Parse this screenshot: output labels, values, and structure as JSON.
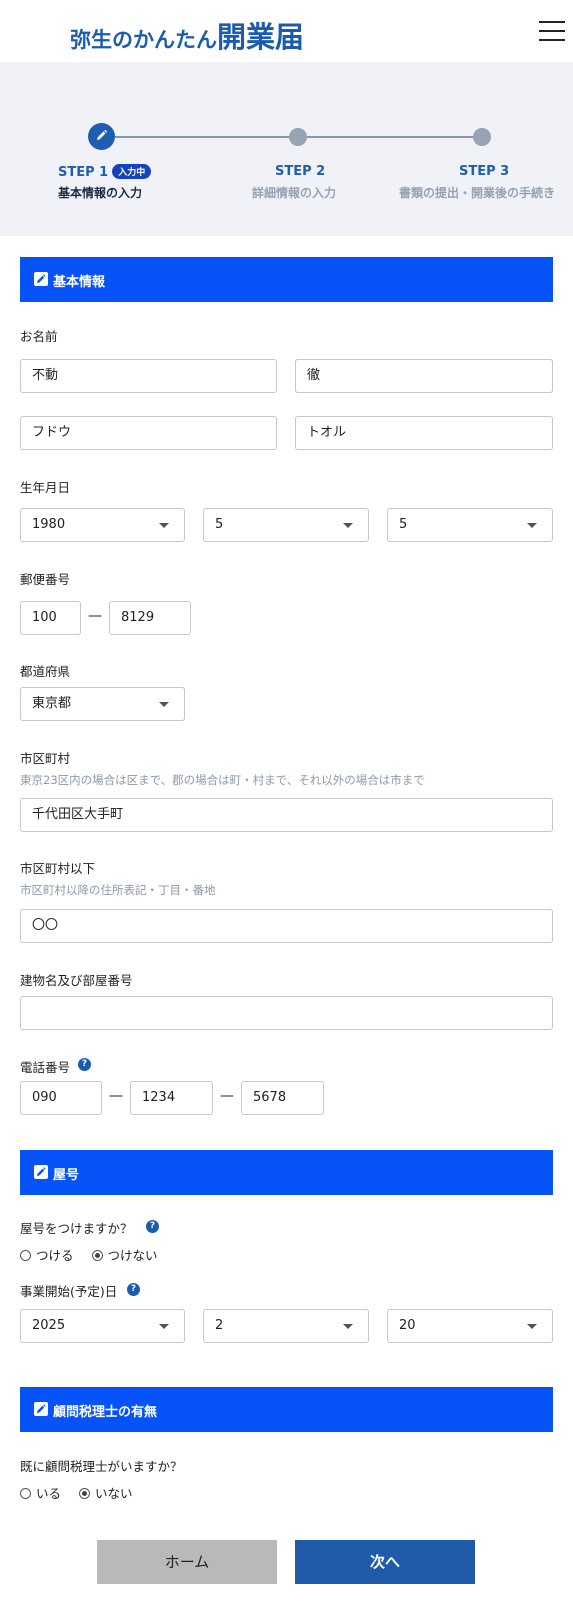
{
  "header": {
    "logo_small": "弥生のかんたん",
    "logo_big": "開業届"
  },
  "steps": [
    {
      "title": "STEP 1",
      "badge": "入力中",
      "subtitle": "基本情報の入力"
    },
    {
      "title": "STEP 2",
      "subtitle": "詳細情報の入力"
    },
    {
      "title": "STEP 3",
      "subtitle": "書類の提出・開業後の手続き"
    }
  ],
  "colors": {
    "brand": "#1b5bb0",
    "section_bar": "#0753fa",
    "step_active_text": "#1b2a44",
    "step_inactive_text": "#97a2b3"
  },
  "basic_info": {
    "section_title": "基本情報",
    "name_label": "お名前",
    "last_name": "不動",
    "first_name": "徹",
    "last_name_kana": "フドウ",
    "first_name_kana": "トオル",
    "birth_label": "生年月日",
    "birth_year": "1980",
    "birth_month": "5",
    "birth_day": "5",
    "postal_label": "郵便番号",
    "postal_1": "100",
    "postal_dash": "—",
    "postal_2": "8129",
    "prefecture_label": "都道府県",
    "prefecture": "東京都",
    "city_label": "市区町村",
    "city_hint": "東京23区内の場合は区まで、郡の場合は町・村まで、それ以外の場合は市まで",
    "city": "千代田区大手町",
    "address_label": "市区町村以下",
    "address_hint": "市区町村以降の住所表記・丁目・番地",
    "address": "〇〇",
    "building_label": "建物名及び部屋番号",
    "building": "",
    "phone_label": "電話番号",
    "phone_1": "090",
    "phone_2": "1234",
    "phone_3": "5678",
    "phone_dash": "—"
  },
  "trade_name": {
    "section_title": "屋号",
    "question": "屋号をつけますか？",
    "option_yes": "つける",
    "option_no": "つけない",
    "selected": "つけない",
    "start_label": "事業開始(予定)日",
    "start_year": "2025",
    "start_month": "2",
    "start_day": "20"
  },
  "tax_advisor": {
    "section_title": "顧問税理士の有無",
    "question": "既に顧問税理士がいますか？",
    "option_yes": "いる",
    "option_no": "いない",
    "selected": "いない"
  },
  "help_glyph": "?",
  "buttons": {
    "home": "ホーム",
    "next": "次へ"
  }
}
